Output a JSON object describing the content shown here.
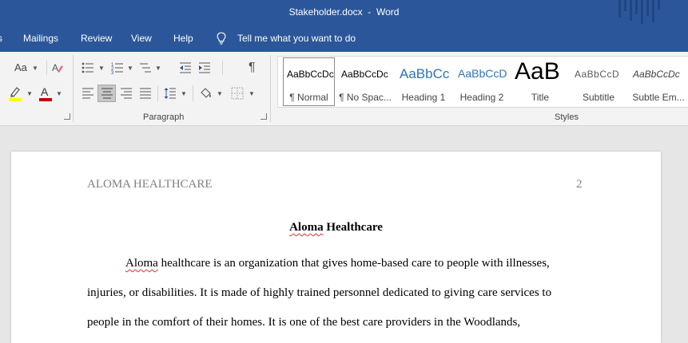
{
  "window": {
    "title": "Stakeholder.docx  -  Word"
  },
  "menu": {
    "items": [
      "Mailings",
      "Review",
      "View",
      "Help"
    ],
    "tell_me": "Tell me what you want to do"
  },
  "ribbon": {
    "font_group": {
      "change_case": "Aa"
    },
    "paragraph_group": {
      "label": "Paragraph"
    },
    "styles_group": {
      "label": "Styles",
      "styles": [
        {
          "sample": "AaBbCcDc",
          "label": "¶ Normal"
        },
        {
          "sample": "AaBbCcDc",
          "label": "¶ No Spac..."
        },
        {
          "sample": "AaBbCc",
          "label": "Heading 1"
        },
        {
          "sample": "AaBbCcD",
          "label": "Heading 2"
        },
        {
          "sample": "AaB",
          "label": "Title"
        },
        {
          "sample": "AaBbCcD",
          "label": "Subtitle"
        },
        {
          "sample": "AaBbCcDc",
          "label": "Subtle Em..."
        }
      ]
    }
  },
  "colors": {
    "brand": "#2b579a",
    "highlight": "#ffff00",
    "font_color": "#c00000"
  },
  "document": {
    "header_left": "ALOMA HEALTHCARE",
    "page_number": "2",
    "title_misspelled": "Aloma",
    "title_rest": " Healthcare",
    "lines": [
      {
        "misspelled": "Aloma",
        "text": " healthcare is an organization that gives home-based care to people with illnesses,"
      },
      {
        "text": "injuries, or disabilities. It is made of highly trained personnel dedicated to giving care services to"
      },
      {
        "text": "people in the comfort of their homes. It is one of the best care providers in the Woodlands,"
      }
    ]
  }
}
